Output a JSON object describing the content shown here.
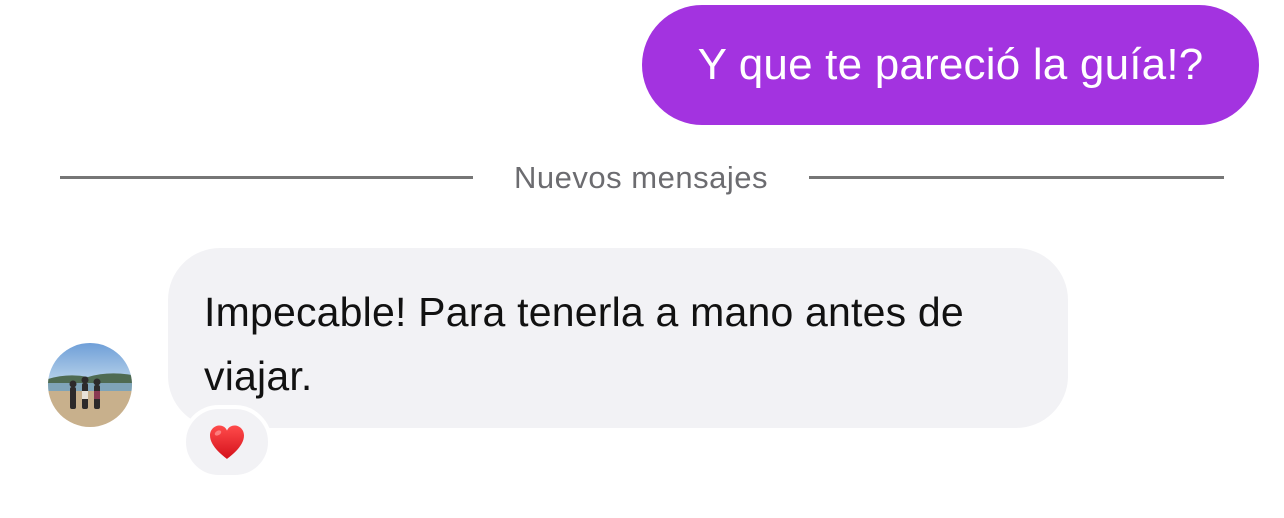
{
  "outgoing_message": {
    "text": "Y que te pareció la guía!?",
    "color": "#a333e0"
  },
  "divider": {
    "label": "Nuevos mensajes"
  },
  "incoming_message": {
    "avatar_icon": "avatar-beach-photo",
    "text": "Impecable! Para tenerla a mano antes de viajar.",
    "reaction_icon": "red-heart-icon",
    "bubble_color": "#f2f2f5"
  }
}
